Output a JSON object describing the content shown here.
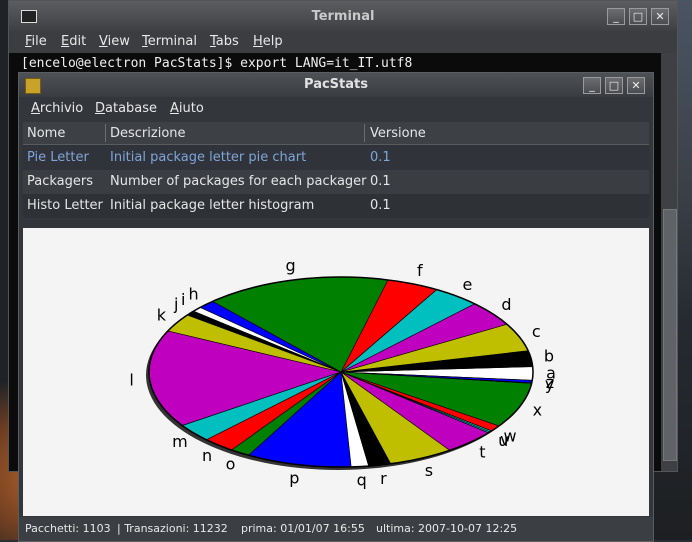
{
  "terminal": {
    "title": "Terminal",
    "menu": [
      "File",
      "Edit",
      "View",
      "Terminal",
      "Tabs",
      "Help"
    ],
    "command_line": "[encelo@electron PacStats]$ export LANG=it_IT.utf8"
  },
  "window_buttons": {
    "minimize": "_",
    "maximize": "□",
    "close": "✕"
  },
  "pacstats": {
    "title": "PacStats",
    "menu": [
      "Archivio",
      "Database",
      "Aiuto"
    ],
    "table": {
      "columns": [
        "Nome",
        "Descrizione",
        "Versione"
      ],
      "rows": [
        {
          "name": "Pie Letter",
          "description": "Initial package letter pie chart",
          "version": "0.1"
        },
        {
          "name": "Packagers",
          "description": "Number of packages for each packager",
          "version": "0.1"
        },
        {
          "name": "Histo Letter",
          "description": "Initial package letter histogram",
          "version": "0.1"
        }
      ]
    },
    "status": {
      "packages": "Pacchetti: 1103",
      "transactions": "| Transazioni: 11232",
      "first": "prima: 01/01/07 16:55",
      "last": "ultima: 2007-10-07 12:25"
    }
  },
  "chart_data": {
    "type": "pie",
    "title": "",
    "slices": [
      {
        "label": "a",
        "value": 2.2,
        "color": "#ffffff"
      },
      {
        "label": "b",
        "value": 2.6,
        "color": "#000000"
      },
      {
        "label": "c",
        "value": 4.6,
        "color": "#bfbf00"
      },
      {
        "label": "d",
        "value": 4.2,
        "color": "#bf00bf"
      },
      {
        "label": "e",
        "value": 3.8,
        "color": "#00bfbf"
      },
      {
        "label": "f",
        "value": 4.2,
        "color": "#ff0000"
      },
      {
        "label": "g",
        "value": 15.0,
        "color": "#008000"
      },
      {
        "label": "h",
        "value": 1.4,
        "color": "#0000ff"
      },
      {
        "label": "i",
        "value": 0.8,
        "color": "#ffffff"
      },
      {
        "label": "j",
        "value": 0.8,
        "color": "#000000"
      },
      {
        "label": "k",
        "value": 3.0,
        "color": "#bfbf00"
      },
      {
        "label": "l",
        "value": 16.0,
        "color": "#bf00bf"
      },
      {
        "label": "m",
        "value": 3.0,
        "color": "#00bfbf"
      },
      {
        "label": "n",
        "value": 2.6,
        "color": "#ff0000"
      },
      {
        "label": "o",
        "value": 1.6,
        "color": "#008000"
      },
      {
        "label": "p",
        "value": 8.5,
        "color": "#0000ff"
      },
      {
        "label": "q",
        "value": 1.4,
        "color": "#ffffff"
      },
      {
        "label": "r",
        "value": 1.8,
        "color": "#000000"
      },
      {
        "label": "s",
        "value": 5.2,
        "color": "#bfbf00"
      },
      {
        "label": "t",
        "value": 4.2,
        "color": "#bf00bf"
      },
      {
        "label": "u",
        "value": 0.2,
        "color": "#00bfbf"
      },
      {
        "label": "v",
        "value": 0.2,
        "color": "#00bfbf"
      },
      {
        "label": "w",
        "value": 1.0,
        "color": "#ff0000"
      },
      {
        "label": "x",
        "value": 7.4,
        "color": "#008000"
      },
      {
        "label": "y",
        "value": 0.1,
        "color": "#00bfbf"
      },
      {
        "label": "z",
        "value": 0.4,
        "color": "#0000ff"
      }
    ]
  }
}
